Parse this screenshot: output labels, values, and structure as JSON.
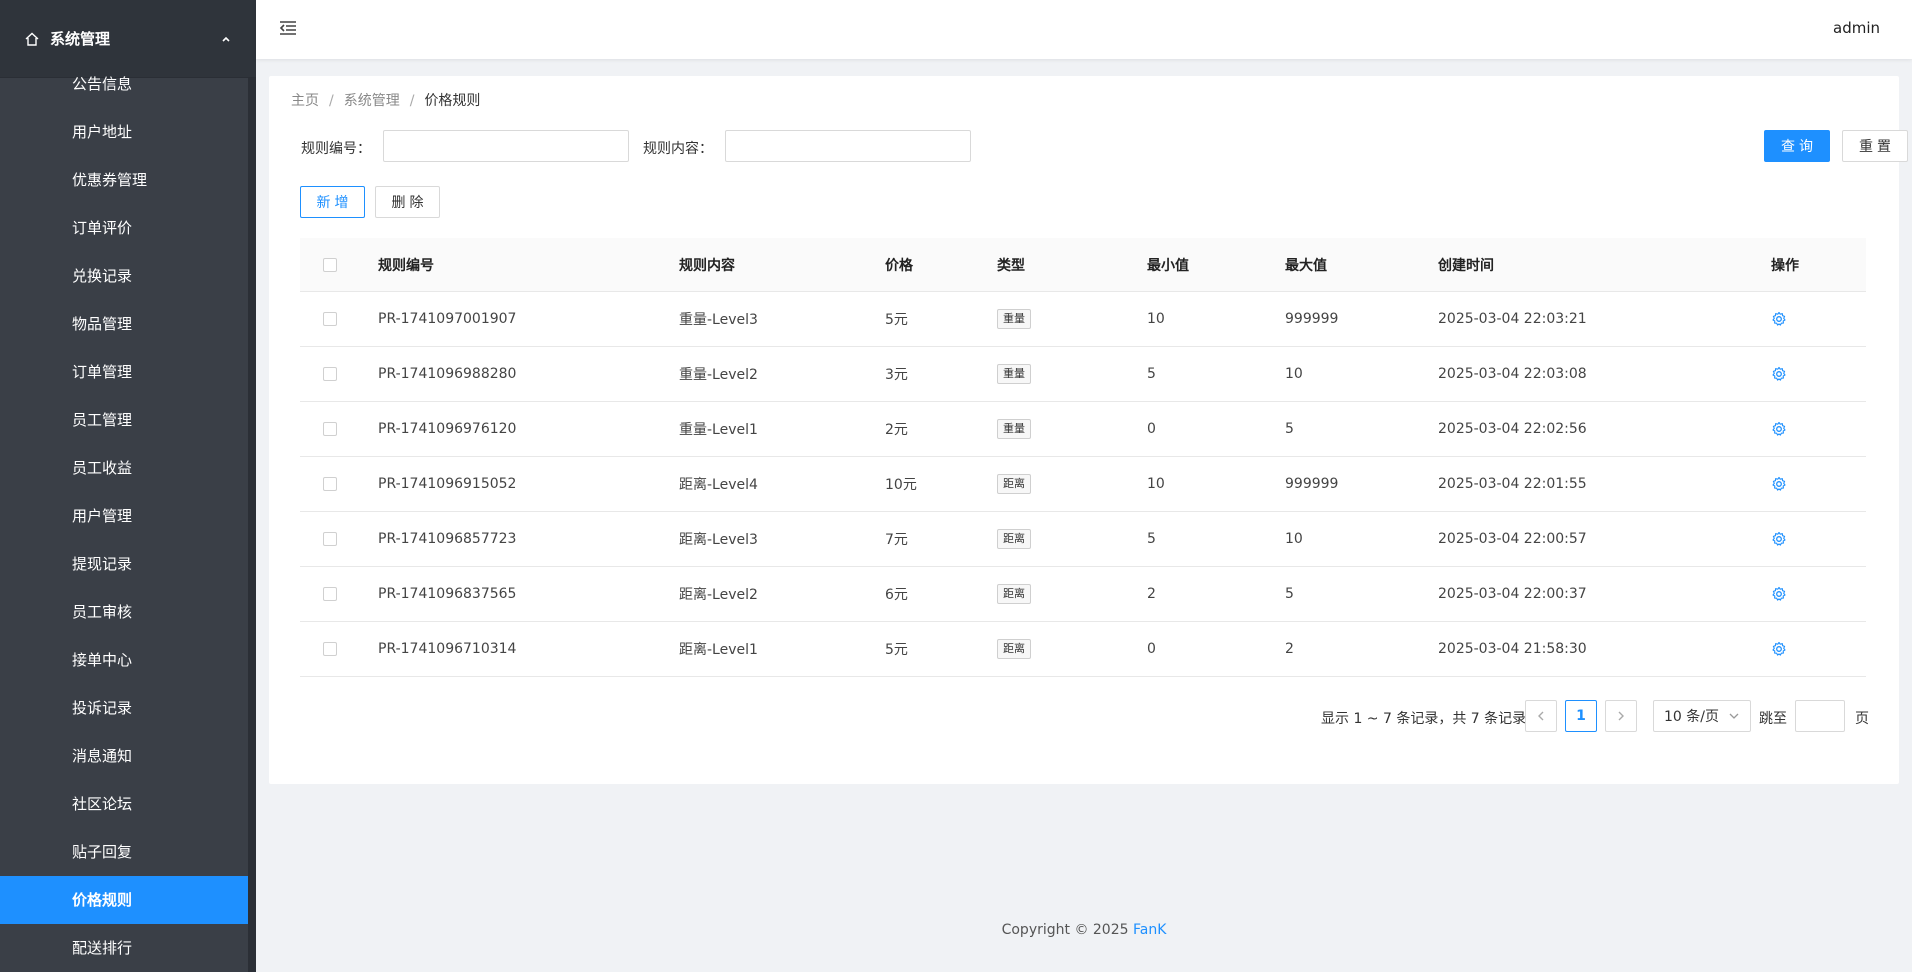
{
  "sidebar": {
    "group_label": "系统管理",
    "items": [
      {
        "label": "公告信息"
      },
      {
        "label": "用户地址"
      },
      {
        "label": "优惠券管理"
      },
      {
        "label": "订单评价"
      },
      {
        "label": "兑换记录"
      },
      {
        "label": "物品管理"
      },
      {
        "label": "订单管理"
      },
      {
        "label": "员工管理"
      },
      {
        "label": "员工收益"
      },
      {
        "label": "用户管理"
      },
      {
        "label": "提现记录"
      },
      {
        "label": "员工审核"
      },
      {
        "label": "接单中心"
      },
      {
        "label": "投诉记录"
      },
      {
        "label": "消息通知"
      },
      {
        "label": "社区论坛"
      },
      {
        "label": "贴子回复"
      },
      {
        "label": "价格规则",
        "active": true
      },
      {
        "label": "配送排行"
      }
    ]
  },
  "header": {
    "user": "admin"
  },
  "breadcrumb": {
    "home": "主页",
    "parent": "系统管理",
    "current": "价格规则"
  },
  "search": {
    "code_label": "规则编号：",
    "code_value": "",
    "content_label": "规则内容：",
    "content_value": "",
    "query_label": "查询",
    "reset_label": "重置"
  },
  "actions": {
    "add_label": "新增",
    "delete_label": "删除"
  },
  "table": {
    "columns": {
      "code": "规则编号",
      "content": "规则内容",
      "price": "价格",
      "type": "类型",
      "min": "最小值",
      "max": "最大值",
      "time": "创建时间",
      "op": "操作"
    },
    "rows": [
      {
        "code": "PR-1741097001907",
        "content": "重量-Level3",
        "price": "5元",
        "type": "重量",
        "min": "10",
        "max": "999999",
        "time": "2025-03-04 22:03:21"
      },
      {
        "code": "PR-1741096988280",
        "content": "重量-Level2",
        "price": "3元",
        "type": "重量",
        "min": "5",
        "max": "10",
        "time": "2025-03-04 22:03:08"
      },
      {
        "code": "PR-1741096976120",
        "content": "重量-Level1",
        "price": "2元",
        "type": "重量",
        "min": "0",
        "max": "5",
        "time": "2025-03-04 22:02:56"
      },
      {
        "code": "PR-1741096915052",
        "content": "距离-Level4",
        "price": "10元",
        "type": "距离",
        "min": "10",
        "max": "999999",
        "time": "2025-03-04 22:01:55"
      },
      {
        "code": "PR-1741096857723",
        "content": "距离-Level3",
        "price": "7元",
        "type": "距离",
        "min": "5",
        "max": "10",
        "time": "2025-03-04 22:00:57"
      },
      {
        "code": "PR-1741096837565",
        "content": "距离-Level2",
        "price": "6元",
        "type": "距离",
        "min": "2",
        "max": "5",
        "time": "2025-03-04 22:00:37"
      },
      {
        "code": "PR-1741096710314",
        "content": "距离-Level1",
        "price": "5元",
        "type": "距离",
        "min": "0",
        "max": "2",
        "time": "2025-03-04 21:58:30"
      }
    ]
  },
  "pagination": {
    "info": "显示 1 ~ 7 条记录，共 7 条记录",
    "current_page": "1",
    "page_size": "10 条/页",
    "jump_label": "跳至",
    "jump_suffix": "页",
    "prev_icon": "chevron-left-icon",
    "next_icon": "chevron-right-icon"
  },
  "footer": {
    "copyright": "Copyright © 2025",
    "brand": "FanK"
  },
  "colors": {
    "accent": "#1e90ff",
    "sidebar_bg": "#3a3f47",
    "page_bg": "#f0f2f5"
  }
}
